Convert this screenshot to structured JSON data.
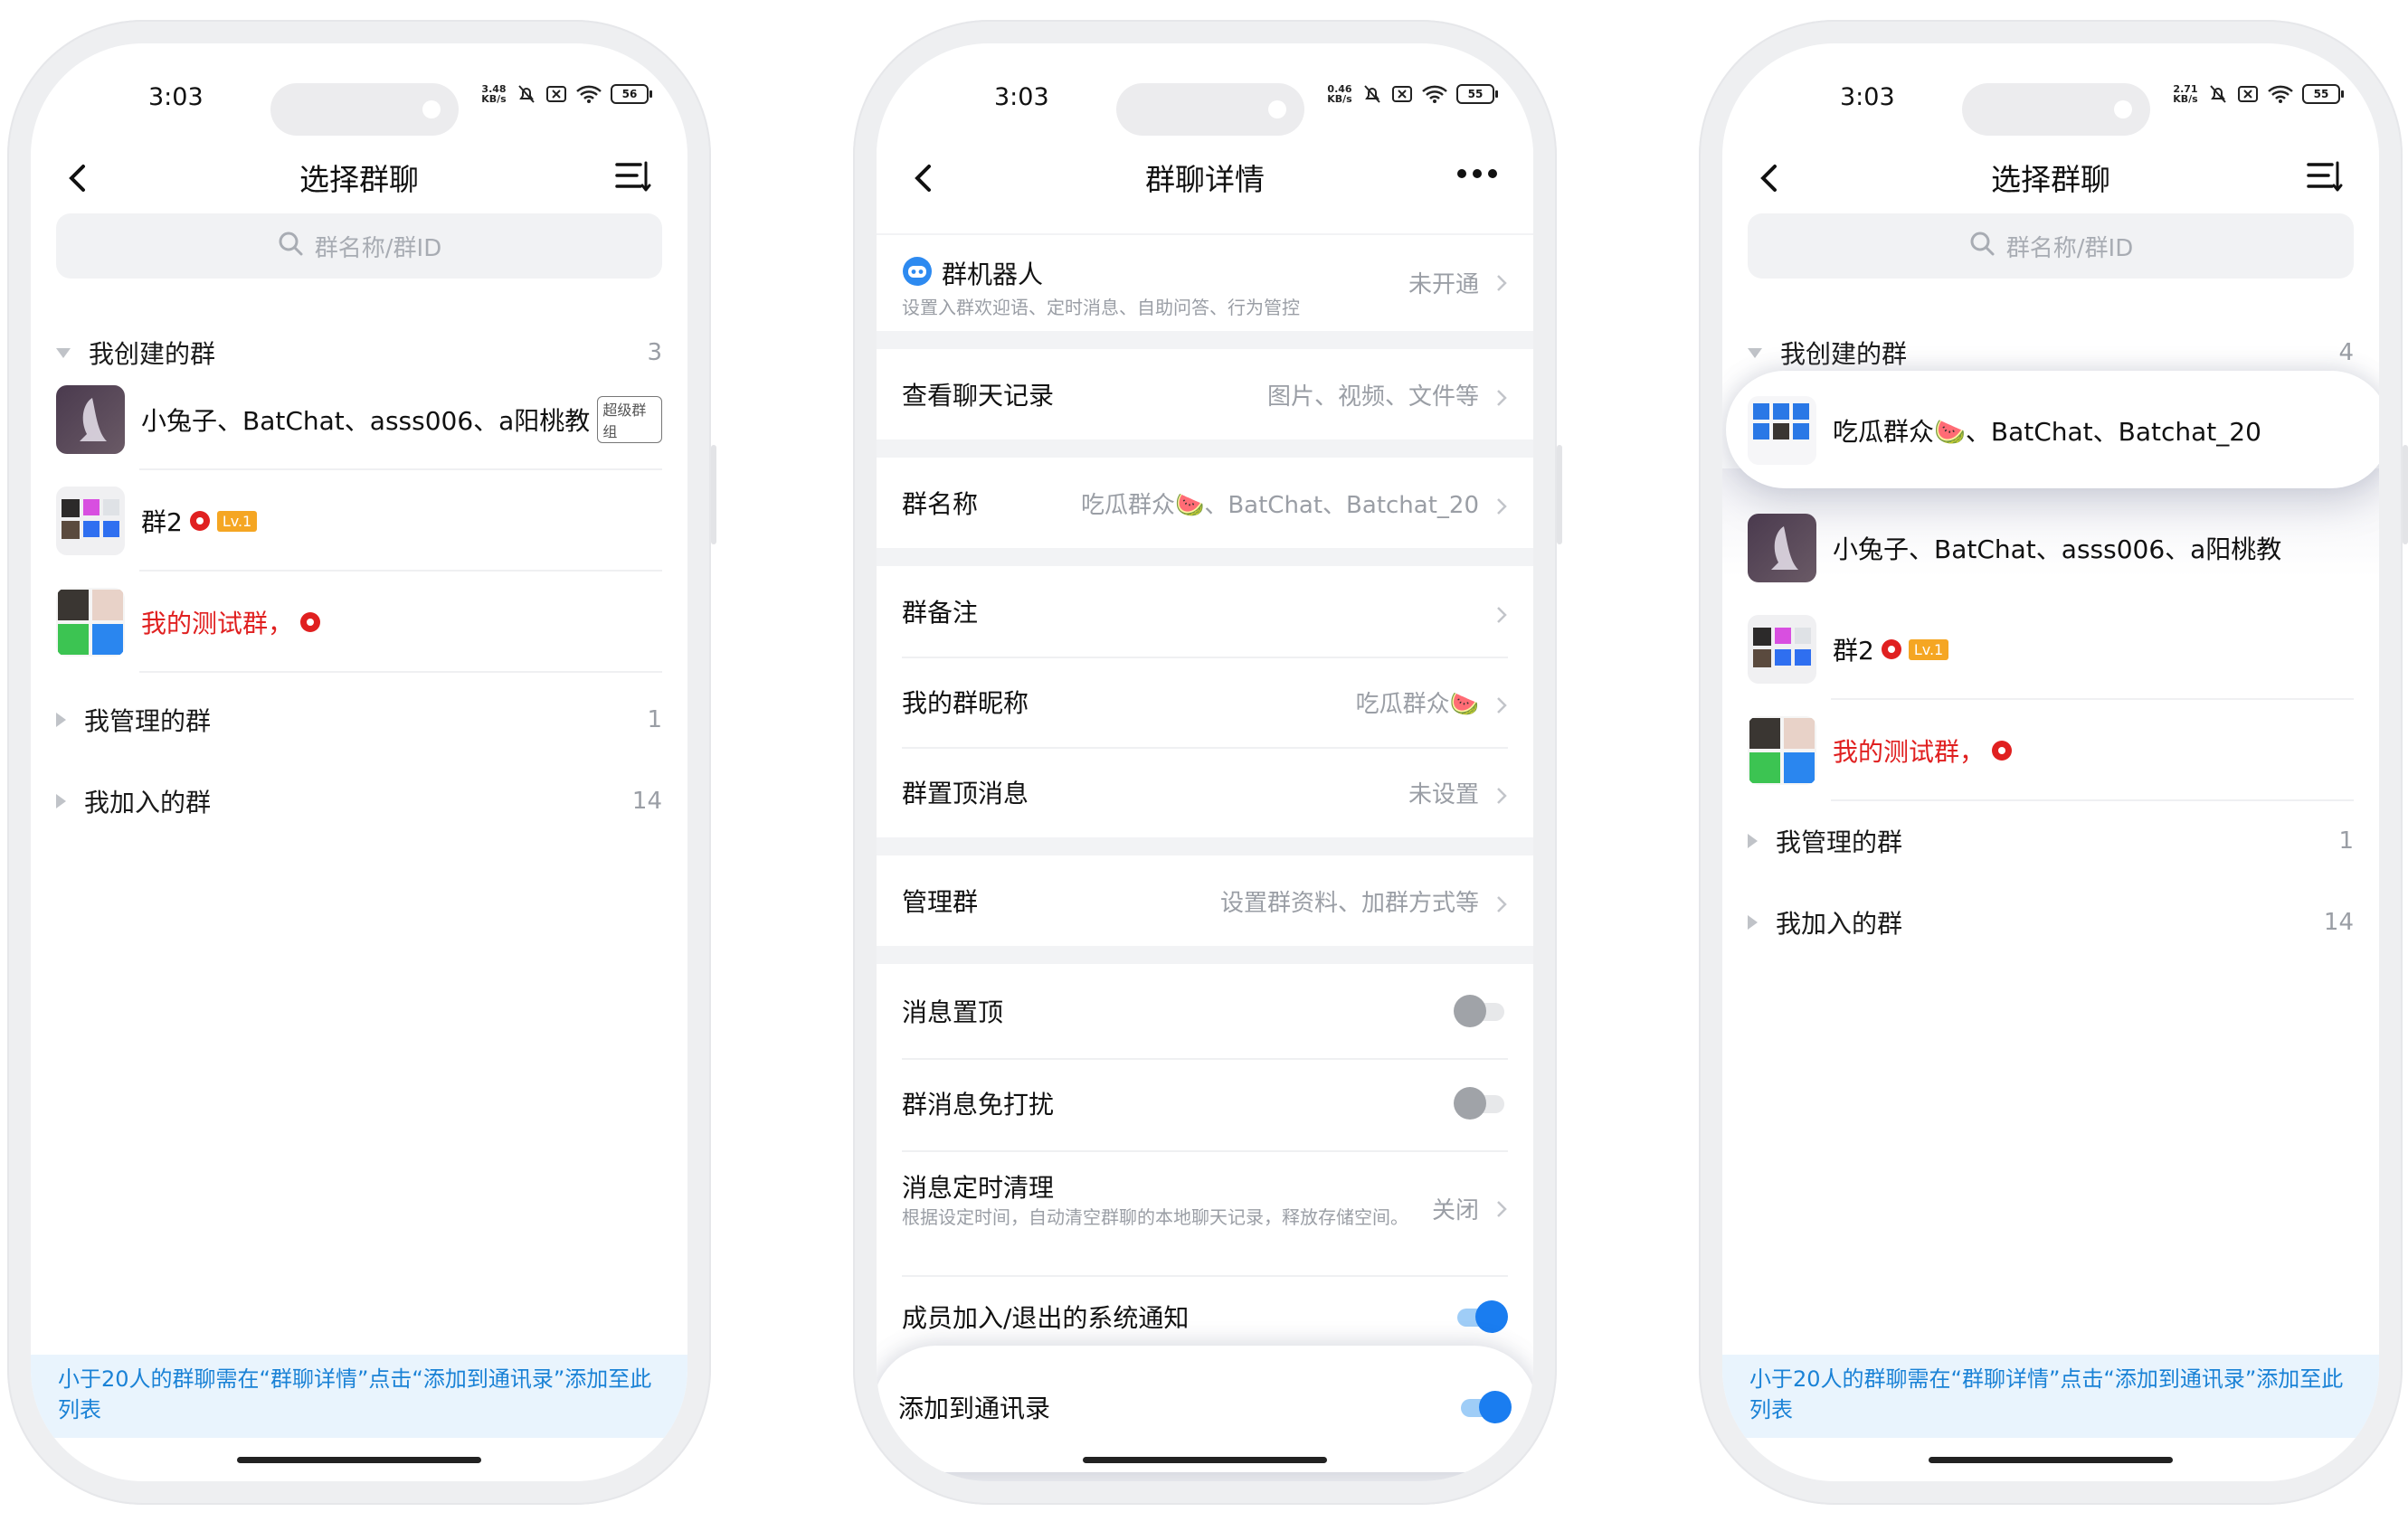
{
  "colors": {
    "accent": "#1a7df0",
    "danger": "#e02020",
    "link": "#1a82d6",
    "note_bg": "#e9f4fd"
  },
  "status": {
    "time": "3:03",
    "battery": "56",
    "battery2": "55",
    "battery3": "55",
    "net1": "3.48 KB/s",
    "net2": "0.46 KB/s",
    "net3": "2.71 KB/s"
  },
  "left": {
    "title": "选择群聊",
    "search_placeholder": "群名称/群ID",
    "created": {
      "label": "我创建的群",
      "count": "3"
    },
    "groups": [
      {
        "name": "小兔子、BatChat、asss006、a阳桃教",
        "tag": "超级群组"
      },
      {
        "name": "群2",
        "level": "Lv.1"
      },
      {
        "name": "我的测试群，"
      }
    ],
    "managed": {
      "label": "我管理的群",
      "count": "1"
    },
    "joined": {
      "label": "我加入的群",
      "count": "14"
    },
    "footnote": "小于20人的群聊需在“群聊详情”点击“添加到通讯录”添加至此列表"
  },
  "middle": {
    "title": "群聊详情",
    "robot": {
      "label": "群机器人",
      "sub": "设置入群欢迎语、定时消息、自助问答、行为管控",
      "value": "未开通"
    },
    "history": {
      "label": "查看聊天记录",
      "value": "图片、视频、文件等"
    },
    "group_name": {
      "label": "群名称",
      "value": "吃瓜群众🍉、BatChat、Batchat_20"
    },
    "remark": {
      "label": "群备注"
    },
    "nickname": {
      "label": "我的群昵称",
      "value": "吃瓜群众🍉"
    },
    "pinned": {
      "label": "群置顶消息",
      "value": "未设置"
    },
    "manage": {
      "label": "管理群",
      "value": "设置群资料、加群方式等"
    },
    "sticky": {
      "label": "消息置顶",
      "on": false
    },
    "mute": {
      "label": "群消息免打扰",
      "on": false
    },
    "cleanup": {
      "label": "消息定时清理",
      "sub": "根据设定时间，自动清空群聊的本地聊天记录，释放存储空间。",
      "value": "关闭"
    },
    "sysnotice": {
      "label": "成员加入/退出的系统通知",
      "on": true
    },
    "contacts": {
      "label": "添加到通讯录",
      "on": true
    }
  },
  "right": {
    "title": "选择群聊",
    "search_placeholder": "群名称/群ID",
    "created": {
      "label": "我创建的群",
      "count": "4"
    },
    "groups": [
      {
        "name": "吃瓜群众🍉、BatChat、Batchat_20"
      },
      {
        "name": "小兔子、BatChat、asss006、a阳桃教"
      },
      {
        "name": "群2",
        "level": "Lv.1"
      },
      {
        "name": "我的测试群，"
      }
    ],
    "managed": {
      "label": "我管理的群",
      "count": "1"
    },
    "joined": {
      "label": "我加入的群",
      "count": "14"
    },
    "footnote": "小于20人的群聊需在“群聊详情”点击“添加到通讯录”添加至此列表"
  }
}
